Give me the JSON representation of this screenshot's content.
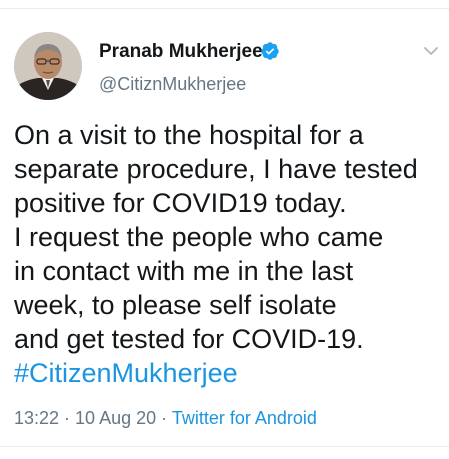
{
  "author": {
    "name": "Pranab Mukherjee",
    "handle": "@CitiznMukherjee",
    "verified": true
  },
  "tweet": {
    "lines": [
      "On a visit to the hospital for a",
      "separate procedure, I have tested",
      "positive for COVID19 today.",
      "I request the people who came",
      "in contact with me in the last",
      "week, to please self isolate",
      "and get tested for COVID-19."
    ],
    "hashtag": "#CitizenMukherjee"
  },
  "meta": {
    "time": "13:22",
    "separator_1": " · ",
    "date": "10 Aug 20",
    "separator_2": " · ",
    "source": "Twitter for Android"
  },
  "icons": {
    "verified": "verified-badge-icon",
    "menu": "chevron-down-icon"
  },
  "colors": {
    "accent": "#1b95e0",
    "verified_badge": "#1da1f2",
    "text": "#14171a",
    "secondary_text": "#657786",
    "divider": "#e6ecf0"
  }
}
